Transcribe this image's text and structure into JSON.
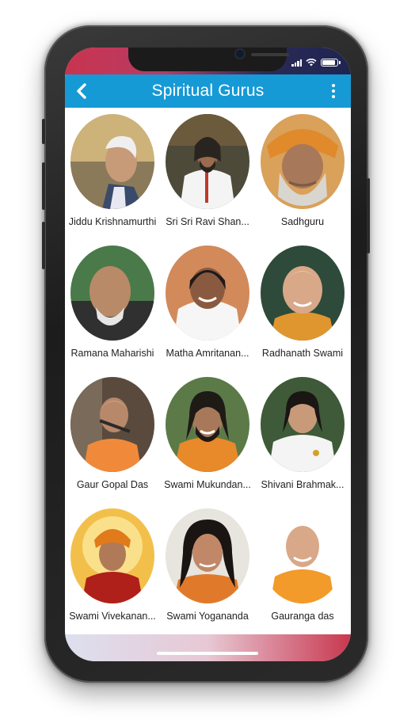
{
  "app_bar": {
    "title": "Spiritual Gurus"
  },
  "accent_color": "#169ad6",
  "gurus": [
    {
      "name": "Jiddu Krishnamurthi"
    },
    {
      "name": "Sri Sri Ravi Shan..."
    },
    {
      "name": "Sadhguru"
    },
    {
      "name": "Ramana Maharishi"
    },
    {
      "name": "Matha Amritanan..."
    },
    {
      "name": "Radhanath Swami"
    },
    {
      "name": "Gaur Gopal Das"
    },
    {
      "name": "Swami Mukundan..."
    },
    {
      "name": "Shivani Brahmak..."
    },
    {
      "name": "Swami Vivekanan..."
    },
    {
      "name": "Swami Yogananda"
    },
    {
      "name": "Gauranga das"
    }
  ]
}
